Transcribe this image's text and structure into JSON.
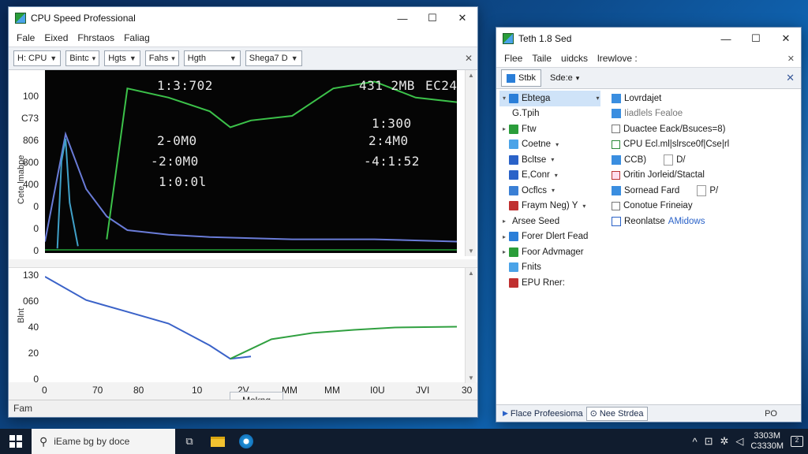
{
  "main_window": {
    "title": "CPU Speed Professional",
    "menu": [
      "Fale",
      "Eixed",
      "Fhrstaos",
      "Faliag"
    ],
    "toolbar": {
      "select1": "H: CPU",
      "select2": "Bintc",
      "select3": "Hgts",
      "select4": "Fahs",
      "select5": "Hgth",
      "select6": "Shega7 D"
    },
    "top_chart": {
      "overlay": [
        "1:3:702",
        "431 2MB",
        "EC24",
        "1:300",
        "2-0M0",
        "2:4M0",
        "-2:0M0",
        "-4:1:52",
        "1:0:0l"
      ],
      "y_label": "Cete lmabpe"
    },
    "bottom_chart": {
      "y_label": "Blnt"
    },
    "x_title": "Mokng",
    "status": "Fam"
  },
  "side_window": {
    "title": "Teth 1.8 Sed",
    "menu": [
      "Flee",
      "Taile",
      "uidcks",
      "lrewlove :"
    ],
    "tabs": [
      "Stbk",
      "Sde:e"
    ],
    "tree": [
      {
        "label": "Ebtega",
        "twisty": "▾",
        "selected": true,
        "color": "#2a7ed8"
      },
      {
        "label": "G.Tpih",
        "twisty": "",
        "color": ""
      },
      {
        "label": "Ftw",
        "twisty": "▸",
        "color": "#2a9d3a"
      },
      {
        "label": "Coetne",
        "twisty": "",
        "color": "#4aa3e8"
      },
      {
        "label": "Bcltse",
        "twisty": "",
        "color": "#2a62c8"
      },
      {
        "label": "E,Conr",
        "twisty": "",
        "color": "#2a62c8"
      },
      {
        "label": "Ocflcs",
        "twisty": "",
        "color": "#3a7fd5"
      },
      {
        "label": "Fraym Neg) Y",
        "twisty": "",
        "color": "#c03030"
      },
      {
        "label": "Arsee Seed",
        "twisty": "▸",
        "color": ""
      },
      {
        "label": "Forer Dlert Fead",
        "twisty": "▸",
        "color": "#2a7ed8"
      },
      {
        "label": "Foor Advmager",
        "twisty": "▸",
        "color": "#2a9d3a"
      },
      {
        "label": "Fnits",
        "twisty": "",
        "color": "#4aa3e8"
      },
      {
        "label": "EPU Rner:",
        "twisty": "",
        "color": "#c03030"
      }
    ],
    "props": [
      {
        "label": "Lovrdajet",
        "kind": "icon"
      },
      {
        "label": "Iiadlels Fealoe",
        "kind": "icon-muted"
      },
      {
        "label": "Duactee Eack/Bsuces=8)",
        "kind": "check"
      },
      {
        "label": "CPU Ecl.ml|slrsce0f|Cse|rl",
        "kind": "check-green"
      },
      {
        "label": "CCB)",
        "kind": "icon",
        "suffix": "D/"
      },
      {
        "label": "Oritin Jorleid/Stactal",
        "kind": "check-red"
      },
      {
        "label": "Sornead Fard",
        "kind": "icon",
        "suffix": "P/"
      },
      {
        "label": "Conotue Frineiay",
        "kind": "check"
      },
      {
        "label": "Reonlatse",
        "kind": "doc",
        "link": "AMidows"
      }
    ],
    "status_tabs": [
      "Flace Profeesioma",
      "Nee Strdea"
    ],
    "status_right": "PO"
  },
  "taskbar": {
    "search_placeholder": "iEame bg by doce",
    "time": "3303M",
    "date": "C3330M"
  },
  "chart_data": [
    {
      "type": "line",
      "title": "",
      "y_ticks": [
        "0",
        "0",
        "0",
        "400",
        "800",
        "806",
        "C73",
        "100"
      ],
      "series": [
        {
          "color": "#6a7cd8",
          "x": [
            0,
            5,
            10,
            15,
            20,
            30,
            40,
            60,
            80,
            100
          ],
          "y": [
            5,
            52,
            28,
            16,
            10,
            8,
            7,
            6,
            6,
            5
          ]
        },
        {
          "color": "#3cc24a",
          "x": [
            15,
            20,
            30,
            40,
            45,
            50,
            60,
            70,
            80,
            90,
            100
          ],
          "y": [
            6,
            72,
            68,
            62,
            55,
            58,
            60,
            72,
            75,
            68,
            66
          ]
        },
        {
          "color": "#40a0c8",
          "x": [
            3,
            4,
            5,
            6,
            8
          ],
          "y": [
            2,
            40,
            50,
            22,
            3
          ]
        }
      ]
    },
    {
      "type": "line",
      "title": "",
      "y_ticks": [
        "0",
        "20",
        "40",
        "060",
        "130"
      ],
      "x_ticks": [
        "0",
        "70",
        "80",
        "10",
        "2V",
        "MM",
        "MM",
        "I0U",
        "JVI",
        "30"
      ],
      "series": [
        {
          "color": "#3a62c8",
          "x": [
            0,
            10,
            20,
            30,
            40,
            45,
            50
          ],
          "y": [
            130,
            100,
            85,
            70,
            42,
            25,
            28
          ]
        },
        {
          "color": "#30a040",
          "x": [
            45,
            55,
            65,
            75,
            85,
            100
          ],
          "y": [
            25,
            50,
            58,
            62,
            65,
            66
          ]
        }
      ]
    }
  ]
}
